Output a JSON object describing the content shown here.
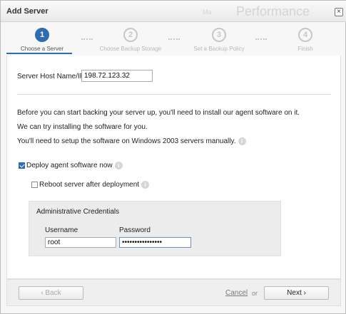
{
  "window": {
    "title": "Add Server",
    "background_fragments": [
      "Ma",
      "Performance"
    ],
    "close_glyph": "×"
  },
  "steps": [
    {
      "number": "1",
      "label": "Choose a Server",
      "active": true
    },
    {
      "number": "2",
      "label": "Choose Backup Storage",
      "active": false
    },
    {
      "number": "3",
      "label": "Set a Backup Policy",
      "active": false
    },
    {
      "number": "4",
      "label": "Finish",
      "active": false
    }
  ],
  "host": {
    "label": "Server Host Name/IP",
    "value": "198.72.123.32"
  },
  "info": {
    "line1": "Before you can start backing your server up, you'll need to install our agent software on it.",
    "line2": "We can try installing the software for you.",
    "line3": "You'll need to setup the software on Windows 2003 servers manually."
  },
  "options": {
    "deploy_label": "Deploy agent software now",
    "deploy_checked": true,
    "reboot_label": "Reboot server after deployment",
    "reboot_checked": false
  },
  "credentials": {
    "title": "Administrative Credentials",
    "username_label": "Username",
    "username_value": "root",
    "password_label": "Password",
    "password_masked": "••••••••••••••••"
  },
  "footer": {
    "back_label": "‹ Back",
    "cancel_label": "Cancel",
    "or_label": "or",
    "next_label": "Next ›"
  },
  "colors": {
    "accent": "#2f6db2",
    "inactive_step": "#c7c7c7"
  },
  "icons": {
    "info": "i"
  }
}
